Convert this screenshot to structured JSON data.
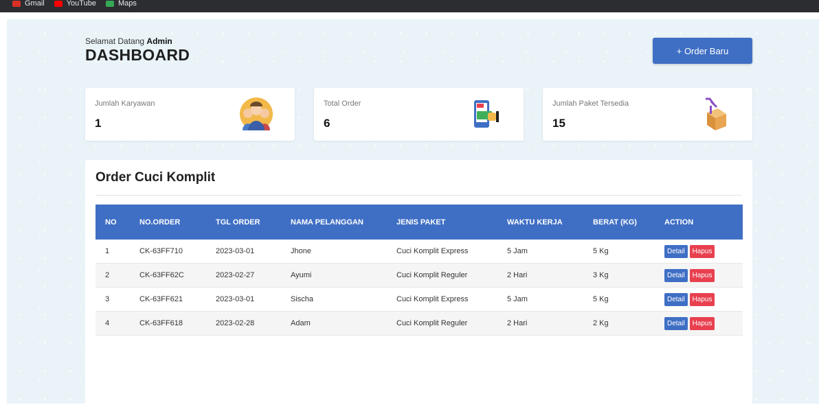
{
  "bookmarks": [
    {
      "label": "Gmail",
      "color": "#d93025"
    },
    {
      "label": "YouTube",
      "color": "#ff0000"
    },
    {
      "label": "Maps",
      "color": "#34a853"
    }
  ],
  "header": {
    "welcome_prefix": "Selamat Datang",
    "user": "Admin",
    "title": "DASHBOARD",
    "order_button": "+ Order Baru"
  },
  "stats": [
    {
      "label": "Jumlah Karyawan",
      "value": "1",
      "icon": "employees-icon"
    },
    {
      "label": "Total Order",
      "value": "6",
      "icon": "order-payment-icon"
    },
    {
      "label": "Jumlah Paket Tersedia",
      "value": "15",
      "icon": "package-trolley-icon"
    }
  ],
  "panel": {
    "title": "Order Cuci Komplit",
    "columns": [
      "NO",
      "NO.ORDER",
      "TGL ORDER",
      "NAMA PELANGGAN",
      "JENIS PAKET",
      "WAKTU KERJA",
      "BERAT (KG)",
      "ACTION"
    ],
    "rows": [
      {
        "no": "1",
        "order": "CK-63FF710",
        "date": "2023-03-01",
        "name": "Jhone",
        "paket": "Cuci Komplit Express",
        "waktu": "5 Jam",
        "berat": "5 Kg"
      },
      {
        "no": "2",
        "order": "CK-63FF62C",
        "date": "2023-02-27",
        "name": "Ayumi",
        "paket": "Cuci Komplit Reguler",
        "waktu": "2 Hari",
        "berat": "3 Kg"
      },
      {
        "no": "3",
        "order": "CK-63FF621",
        "date": "2023-03-01",
        "name": "Sischa",
        "paket": "Cuci Komplit Express",
        "waktu": "5 Jam",
        "berat": "5 Kg"
      },
      {
        "no": "4",
        "order": "CK-63FF618",
        "date": "2023-02-28",
        "name": "Adam",
        "paket": "Cuci Komplit Reguler",
        "waktu": "2 Hari",
        "berat": "2 Kg"
      }
    ],
    "detail_label": "Detail",
    "hapus_label": "Hapus"
  },
  "colors": {
    "accent": "#3f6fc4",
    "danger": "#e8404f",
    "background": "#e9f3f8"
  }
}
